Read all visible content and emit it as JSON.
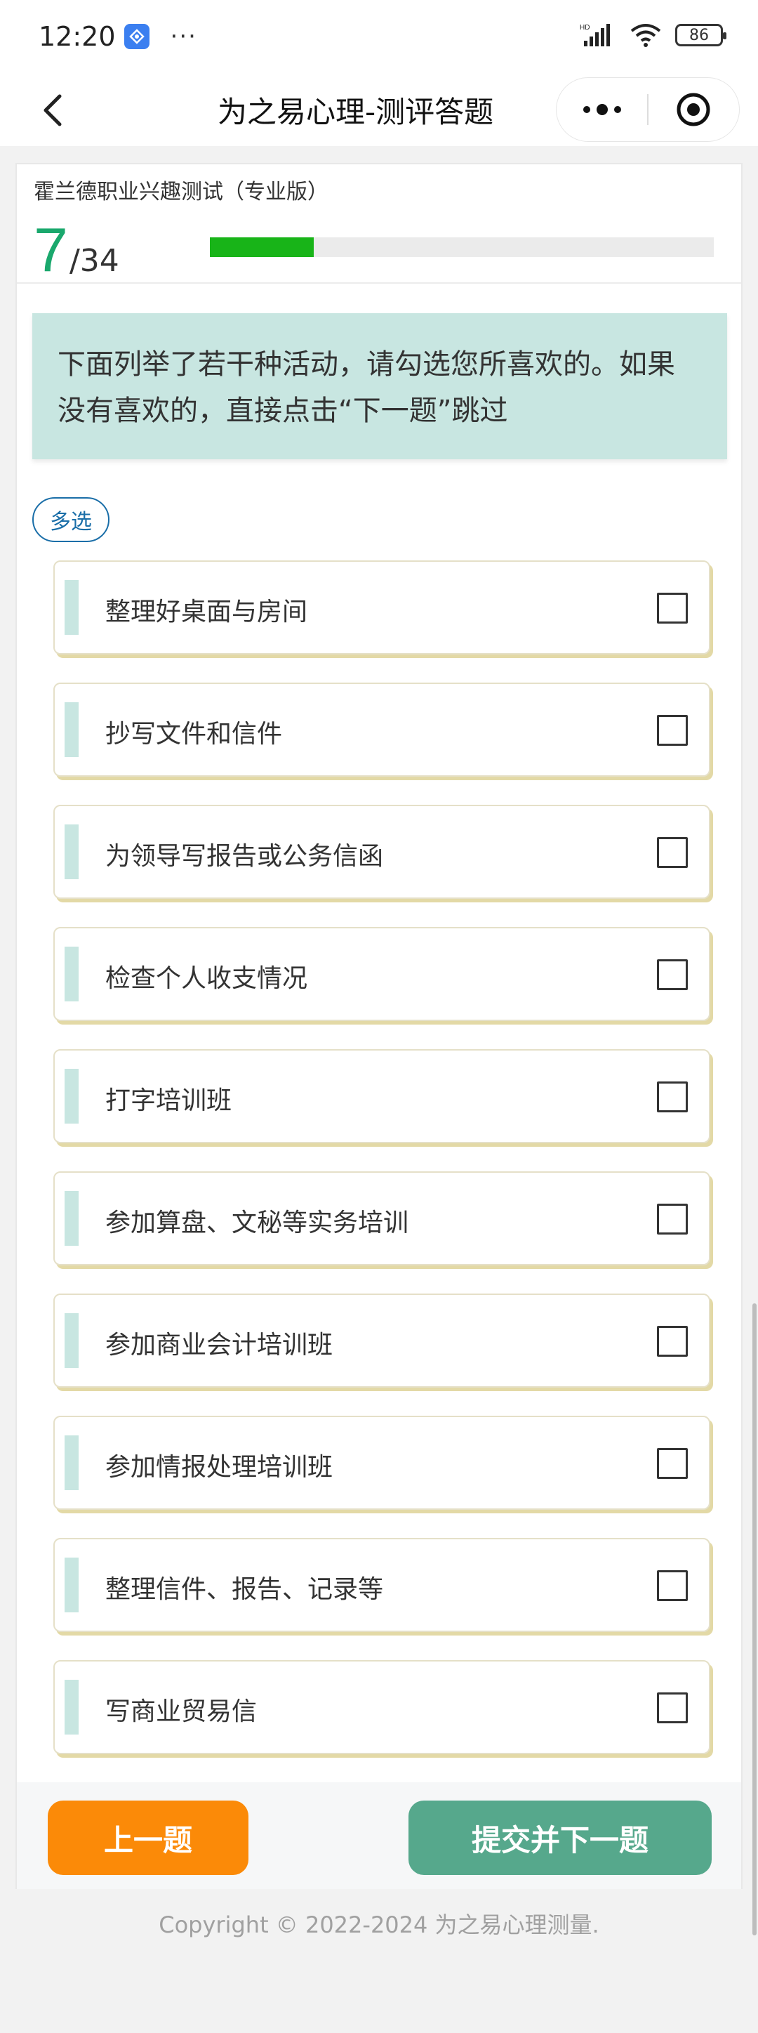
{
  "status_bar": {
    "time": "12:20",
    "dots": "···",
    "battery": "86",
    "network": "HD"
  },
  "nav": {
    "title": "为之易心理-测评答题"
  },
  "quiz": {
    "name": "霍兰德职业兴趣测试（专业版）",
    "current": "7",
    "total": "/34",
    "progress_fraction": 0.206
  },
  "question": {
    "text": "下面列举了若干种活动，请勾选您所喜欢的。如果没有喜欢的，直接点击“下一题”跳过",
    "type_badge": "多选"
  },
  "options": [
    {
      "label": "整理好桌面与房间",
      "checked": false
    },
    {
      "label": "抄写文件和信件",
      "checked": false
    },
    {
      "label": "为领导写报告或公务信函",
      "checked": false
    },
    {
      "label": "检查个人收支情况",
      "checked": false
    },
    {
      "label": "打字培训班",
      "checked": false
    },
    {
      "label": "参加算盘、文秘等实务培训",
      "checked": false
    },
    {
      "label": "参加商业会计培训班",
      "checked": false
    },
    {
      "label": "参加情报处理培训班",
      "checked": false
    },
    {
      "label": "整理信件、报告、记录等",
      "checked": false
    },
    {
      "label": "写商业贸易信",
      "checked": false
    }
  ],
  "buttons": {
    "prev": "上一题",
    "next": "提交并下一题"
  },
  "footer": {
    "copyright": "Copyright © 2022-2024 为之易心理测量."
  },
  "colors": {
    "accent_green": "#1aa86d",
    "progress_fill": "#18b418",
    "prev_button": "#fb8a08",
    "next_button": "#56a88c",
    "question_bg": "#c8e6e1",
    "badge_blue": "#1a6ea8"
  }
}
